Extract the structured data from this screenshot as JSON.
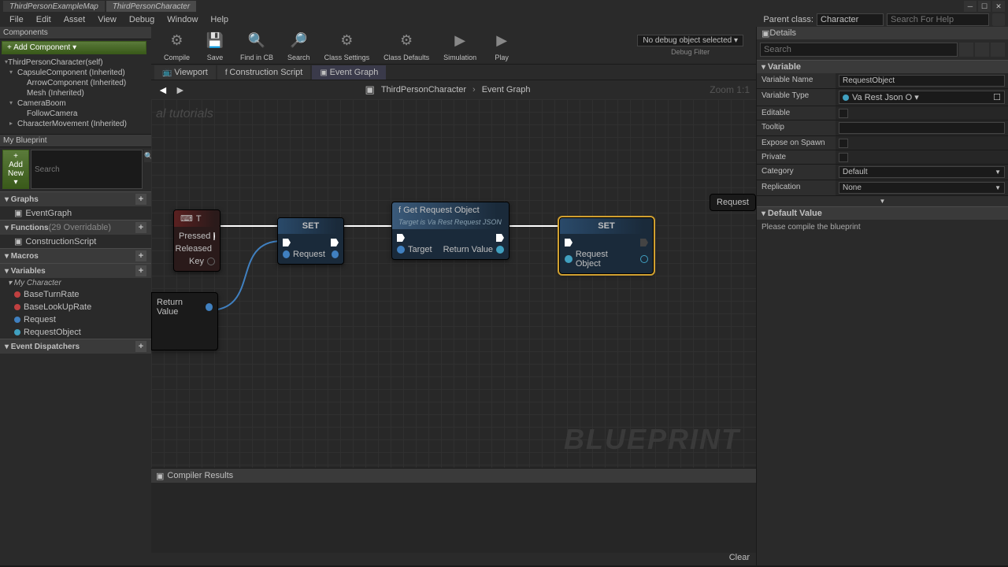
{
  "tabs": [
    "ThirdPersonExampleMap",
    "ThirdPersonCharacter"
  ],
  "menu": [
    "File",
    "Edit",
    "Asset",
    "View",
    "Debug",
    "Window",
    "Help"
  ],
  "parentClass": {
    "label": "Parent class:",
    "value": "Character"
  },
  "searchHelp": "Search For Help",
  "components": {
    "title": "Components",
    "addBtn": "+ Add Component ▾",
    "items": [
      {
        "label": "ThirdPersonCharacter(self)",
        "lvl": 1,
        "exp": true
      },
      {
        "label": "CapsuleComponent (Inherited)",
        "lvl": 2,
        "exp": true
      },
      {
        "label": "ArrowComponent (Inherited)",
        "lvl": 3
      },
      {
        "label": "Mesh (Inherited)",
        "lvl": 3
      },
      {
        "label": "CameraBoom",
        "lvl": 2,
        "exp": true
      },
      {
        "label": "FollowCamera",
        "lvl": 3
      },
      {
        "label": "CharacterMovement (Inherited)",
        "lvl": 2
      }
    ]
  },
  "myBlueprint": {
    "title": "My Blueprint",
    "addNew": "+ Add New ▾",
    "searchPh": "Search",
    "cats": [
      {
        "name": "Graphs",
        "items": [
          {
            "label": "EventGraph"
          }
        ]
      },
      {
        "name": "Functions",
        "note": "(29 Overridable)",
        "items": [
          {
            "label": "ConstructionScript"
          }
        ]
      },
      {
        "name": "Macros",
        "items": []
      },
      {
        "name": "Variables",
        "subcat": "My Character",
        "items": [
          {
            "label": "BaseTurnRate",
            "color": "red"
          },
          {
            "label": "BaseLookUpRate",
            "color": "red"
          },
          {
            "label": "Request",
            "color": "blue"
          },
          {
            "label": "RequestObject",
            "color": "cyan"
          }
        ]
      },
      {
        "name": "Event Dispatchers",
        "items": []
      }
    ]
  },
  "toolbar": [
    {
      "label": "Compile",
      "icon": "⚙"
    },
    {
      "label": "Save",
      "icon": "💾"
    },
    {
      "label": "Find in CB",
      "icon": "🔍"
    },
    {
      "label": "Search",
      "icon": "🔎"
    },
    {
      "label": "Class Settings",
      "icon": "⚙"
    },
    {
      "label": "Class Defaults",
      "icon": "⚙"
    },
    {
      "label": "Simulation",
      "icon": "▶"
    },
    {
      "label": "Play",
      "icon": "▶"
    }
  ],
  "debug": {
    "sel": "No debug object selected ▾",
    "label": "Debug Filter"
  },
  "subtabs": [
    "Viewport",
    "Construction Script",
    "Event Graph"
  ],
  "breadcrumb": {
    "a": "ThirdPersonCharacter",
    "b": "Event Graph"
  },
  "zoom": "Zoom 1:1",
  "watermark": "al tutorials",
  "bpwm": "BLUEPRINT",
  "nodes": {
    "key": {
      "title": "T",
      "pressed": "Pressed",
      "released": "Released",
      "keypin": "Key"
    },
    "set1": {
      "title": "SET",
      "pin": "Request"
    },
    "fn": {
      "title": "Get Request Object",
      "sub": "Target is Va Rest Request JSON",
      "target": "Target",
      "ret": "Return Value"
    },
    "set2": {
      "title": "SET",
      "pin": "Request Object"
    },
    "rv": {
      "label": "Return Value"
    },
    "partial": "Request"
  },
  "compiler": {
    "title": "Compiler Results",
    "clear": "Clear"
  },
  "details": {
    "title": "Details",
    "searchPh": "Search",
    "sect1": "Variable",
    "rows": [
      {
        "label": "Variable Name",
        "type": "text",
        "value": "RequestObject"
      },
      {
        "label": "Variable Type",
        "type": "type",
        "value": "Va Rest Json O ▾"
      },
      {
        "label": "Editable",
        "type": "chk"
      },
      {
        "label": "Tooltip",
        "type": "text",
        "value": ""
      },
      {
        "label": "Expose on Spawn",
        "type": "chk"
      },
      {
        "label": "Private",
        "type": "chk"
      },
      {
        "label": "Category",
        "type": "sel",
        "value": "Default"
      },
      {
        "label": "Replication",
        "type": "sel",
        "value": "None"
      }
    ],
    "sect2": "Default Value",
    "msg": "Please compile the blueprint"
  }
}
